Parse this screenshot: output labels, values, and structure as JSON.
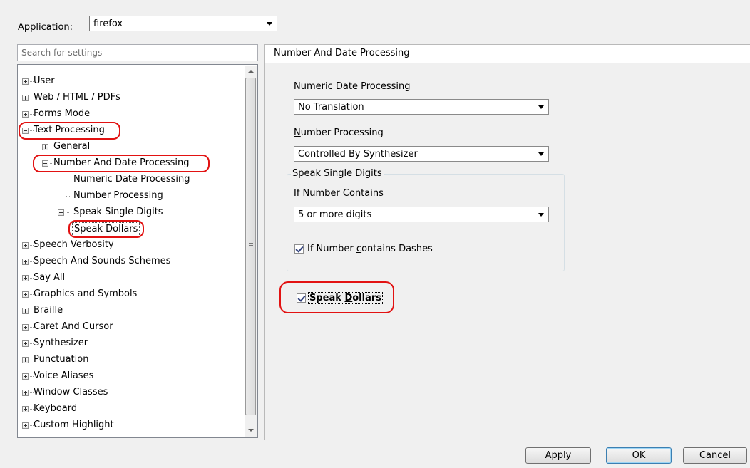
{
  "header": {
    "application_label": "Application:",
    "application_value": "firefox"
  },
  "search": {
    "placeholder": "Search for settings"
  },
  "tree": {
    "items": [
      {
        "label": "User",
        "expander": "plus"
      },
      {
        "label": "Web / HTML / PDFs",
        "expander": "plus"
      },
      {
        "label": "Forms Mode",
        "expander": "plus"
      },
      {
        "label": "Text Processing",
        "expander": "minus",
        "highlighted": true
      },
      {
        "label": "General",
        "expander": "plus"
      },
      {
        "label": "Number And Date Processing",
        "expander": "minus",
        "highlighted": true
      },
      {
        "label": "Numeric Date Processing"
      },
      {
        "label": "Number Processing"
      },
      {
        "label": "Speak Single Digits",
        "expander": "plus"
      },
      {
        "label": "Speak Dollars",
        "selected": true,
        "highlighted": true
      },
      {
        "label": "Speech Verbosity",
        "expander": "plus"
      },
      {
        "label": "Speech And Sounds Schemes",
        "expander": "plus"
      },
      {
        "label": "Say All",
        "expander": "plus"
      },
      {
        "label": "Graphics and Symbols",
        "expander": "plus"
      },
      {
        "label": "Braille",
        "expander": "plus"
      },
      {
        "label": "Caret And Cursor",
        "expander": "plus"
      },
      {
        "label": "Synthesizer",
        "expander": "plus"
      },
      {
        "label": "Punctuation",
        "expander": "plus"
      },
      {
        "label": "Voice Aliases",
        "expander": "plus"
      },
      {
        "label": "Window Classes",
        "expander": "plus"
      },
      {
        "label": "Keyboard",
        "expander": "plus"
      },
      {
        "label": "Custom Highlight",
        "expander": "plus"
      }
    ]
  },
  "panel": {
    "title": "Number And Date Processing",
    "numeric_date": {
      "label_pre": "Numeric Da",
      "label_key": "t",
      "label_post": "e Processing",
      "value": "No Translation"
    },
    "number_processing": {
      "label_pre": "",
      "label_key": "N",
      "label_post": "umber Processing",
      "value": "Controlled By Synthesizer"
    },
    "single_digits": {
      "group_pre": "Speak ",
      "group_key": "S",
      "group_post": "ingle Digits",
      "label_pre": "",
      "label_key": "I",
      "label_post": "f Number Contains",
      "value": "5 or more digits",
      "dashes_pre": "If Number ",
      "dashes_key": "c",
      "dashes_post": "ontains Dashes",
      "dashes_checked": true
    },
    "speak_dollars": {
      "pre": "Speak ",
      "key": "D",
      "post": "ollars",
      "checked": true
    }
  },
  "buttons": {
    "apply_key": "A",
    "apply_post": "pply",
    "ok": "OK",
    "cancel": "Cancel"
  },
  "colors": {
    "highlight_ring": "#e21212",
    "checkmark": "#2d3d7a"
  }
}
